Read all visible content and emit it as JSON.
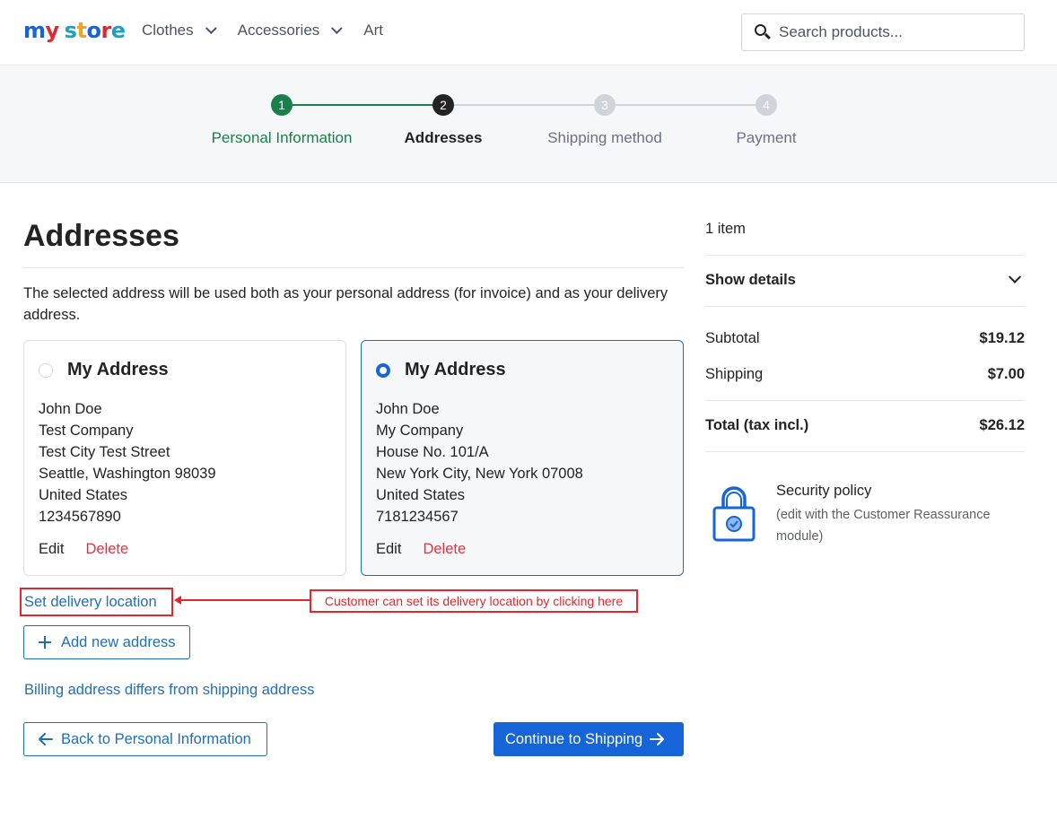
{
  "header": {
    "logo": {
      "parts": [
        {
          "text": "m",
          "color": "#1565d8"
        },
        {
          "text": "y",
          "color": "#e0282e"
        },
        {
          "text": " ",
          "color": "#ffffff"
        },
        {
          "text": "s",
          "color": "#1ba1c7"
        },
        {
          "text": "t",
          "color": "#f4a31a"
        },
        {
          "text": "o",
          "color": "#1565d8"
        },
        {
          "text": "r",
          "color": "#e0282e"
        },
        {
          "text": "e",
          "color": "#1ba1c7"
        }
      ]
    },
    "nav": [
      {
        "label": "Clothes",
        "has_dropdown": true
      },
      {
        "label": "Accessories",
        "has_dropdown": true
      },
      {
        "label": "Art",
        "has_dropdown": false
      }
    ],
    "search": {
      "placeholder": "Search products...",
      "value": ""
    }
  },
  "stepper": {
    "steps": [
      {
        "number": "1",
        "label": "Personal Information",
        "state": "done"
      },
      {
        "number": "2",
        "label": "Addresses",
        "state": "current"
      },
      {
        "number": "3",
        "label": "Shipping method",
        "state": "upcoming"
      },
      {
        "number": "4",
        "label": "Payment",
        "state": "upcoming"
      }
    ],
    "colors": {
      "done": "#1a7f4b",
      "current": "#232323",
      "upcoming": "#ced4da",
      "upcoming_text": "#6b7280"
    }
  },
  "main": {
    "title": "Addresses",
    "intro": "The selected address will be used both as your personal address (for invoice) and as your delivery address.",
    "addresses": [
      {
        "name": "My Address",
        "selected": false,
        "lines": [
          "John Doe",
          "Test Company",
          "Test City Test Street",
          "Seattle, Washington 98039",
          "United States",
          "1234567890"
        ],
        "edit_label": "Edit",
        "delete_label": "Delete"
      },
      {
        "name": "My Address",
        "selected": true,
        "lines": [
          "John Doe",
          "My Company",
          "House No. 101/A",
          "New York City, New York 07008",
          "United States",
          "7181234567"
        ],
        "edit_label": "Edit",
        "delete_label": "Delete"
      }
    ],
    "set_delivery_label": "Set delivery location",
    "annotation": "Customer can set its delivery location by clicking here",
    "add_address_label": "Add new address",
    "billing_link": "Billing address differs from shipping address",
    "back_label": "Back to Personal Information",
    "continue_label": "Continue to Shipping"
  },
  "summary": {
    "count": "1 item",
    "show_details": "Show details",
    "subtotal_label": "Subtotal",
    "subtotal_value": "$19.12",
    "shipping_label": "Shipping",
    "shipping_value": "$7.00",
    "total_label": "Total (tax incl.)",
    "total_value": "$26.12",
    "security_title": "Security policy",
    "security_desc": "(edit with the Customer Reassurance module)"
  },
  "colors": {
    "accent": "#1565d8",
    "link": "#1f6fb8",
    "danger": "#dc3545",
    "annotation": "#e0282e"
  }
}
